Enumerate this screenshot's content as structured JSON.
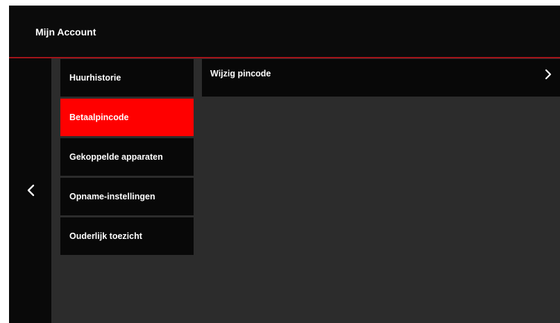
{
  "header": {
    "title": "Mijn Account"
  },
  "menu": {
    "items": [
      {
        "label": "Huurhistorie",
        "active": false
      },
      {
        "label": "Betaalpincode",
        "active": true
      },
      {
        "label": "Gekoppelde apparaten",
        "active": false
      },
      {
        "label": "Opname-instellingen",
        "active": false
      },
      {
        "label": "Ouderlijk toezicht",
        "active": false
      }
    ]
  },
  "content": {
    "option_label": "Wijzig pincode"
  },
  "icons": {
    "back": "chevron-left-icon",
    "forward": "chevron-right-icon"
  },
  "colors": {
    "accent": "#ff0000",
    "header_border": "#a3141a",
    "panel": "#080808",
    "background": "#2c2c2c"
  }
}
